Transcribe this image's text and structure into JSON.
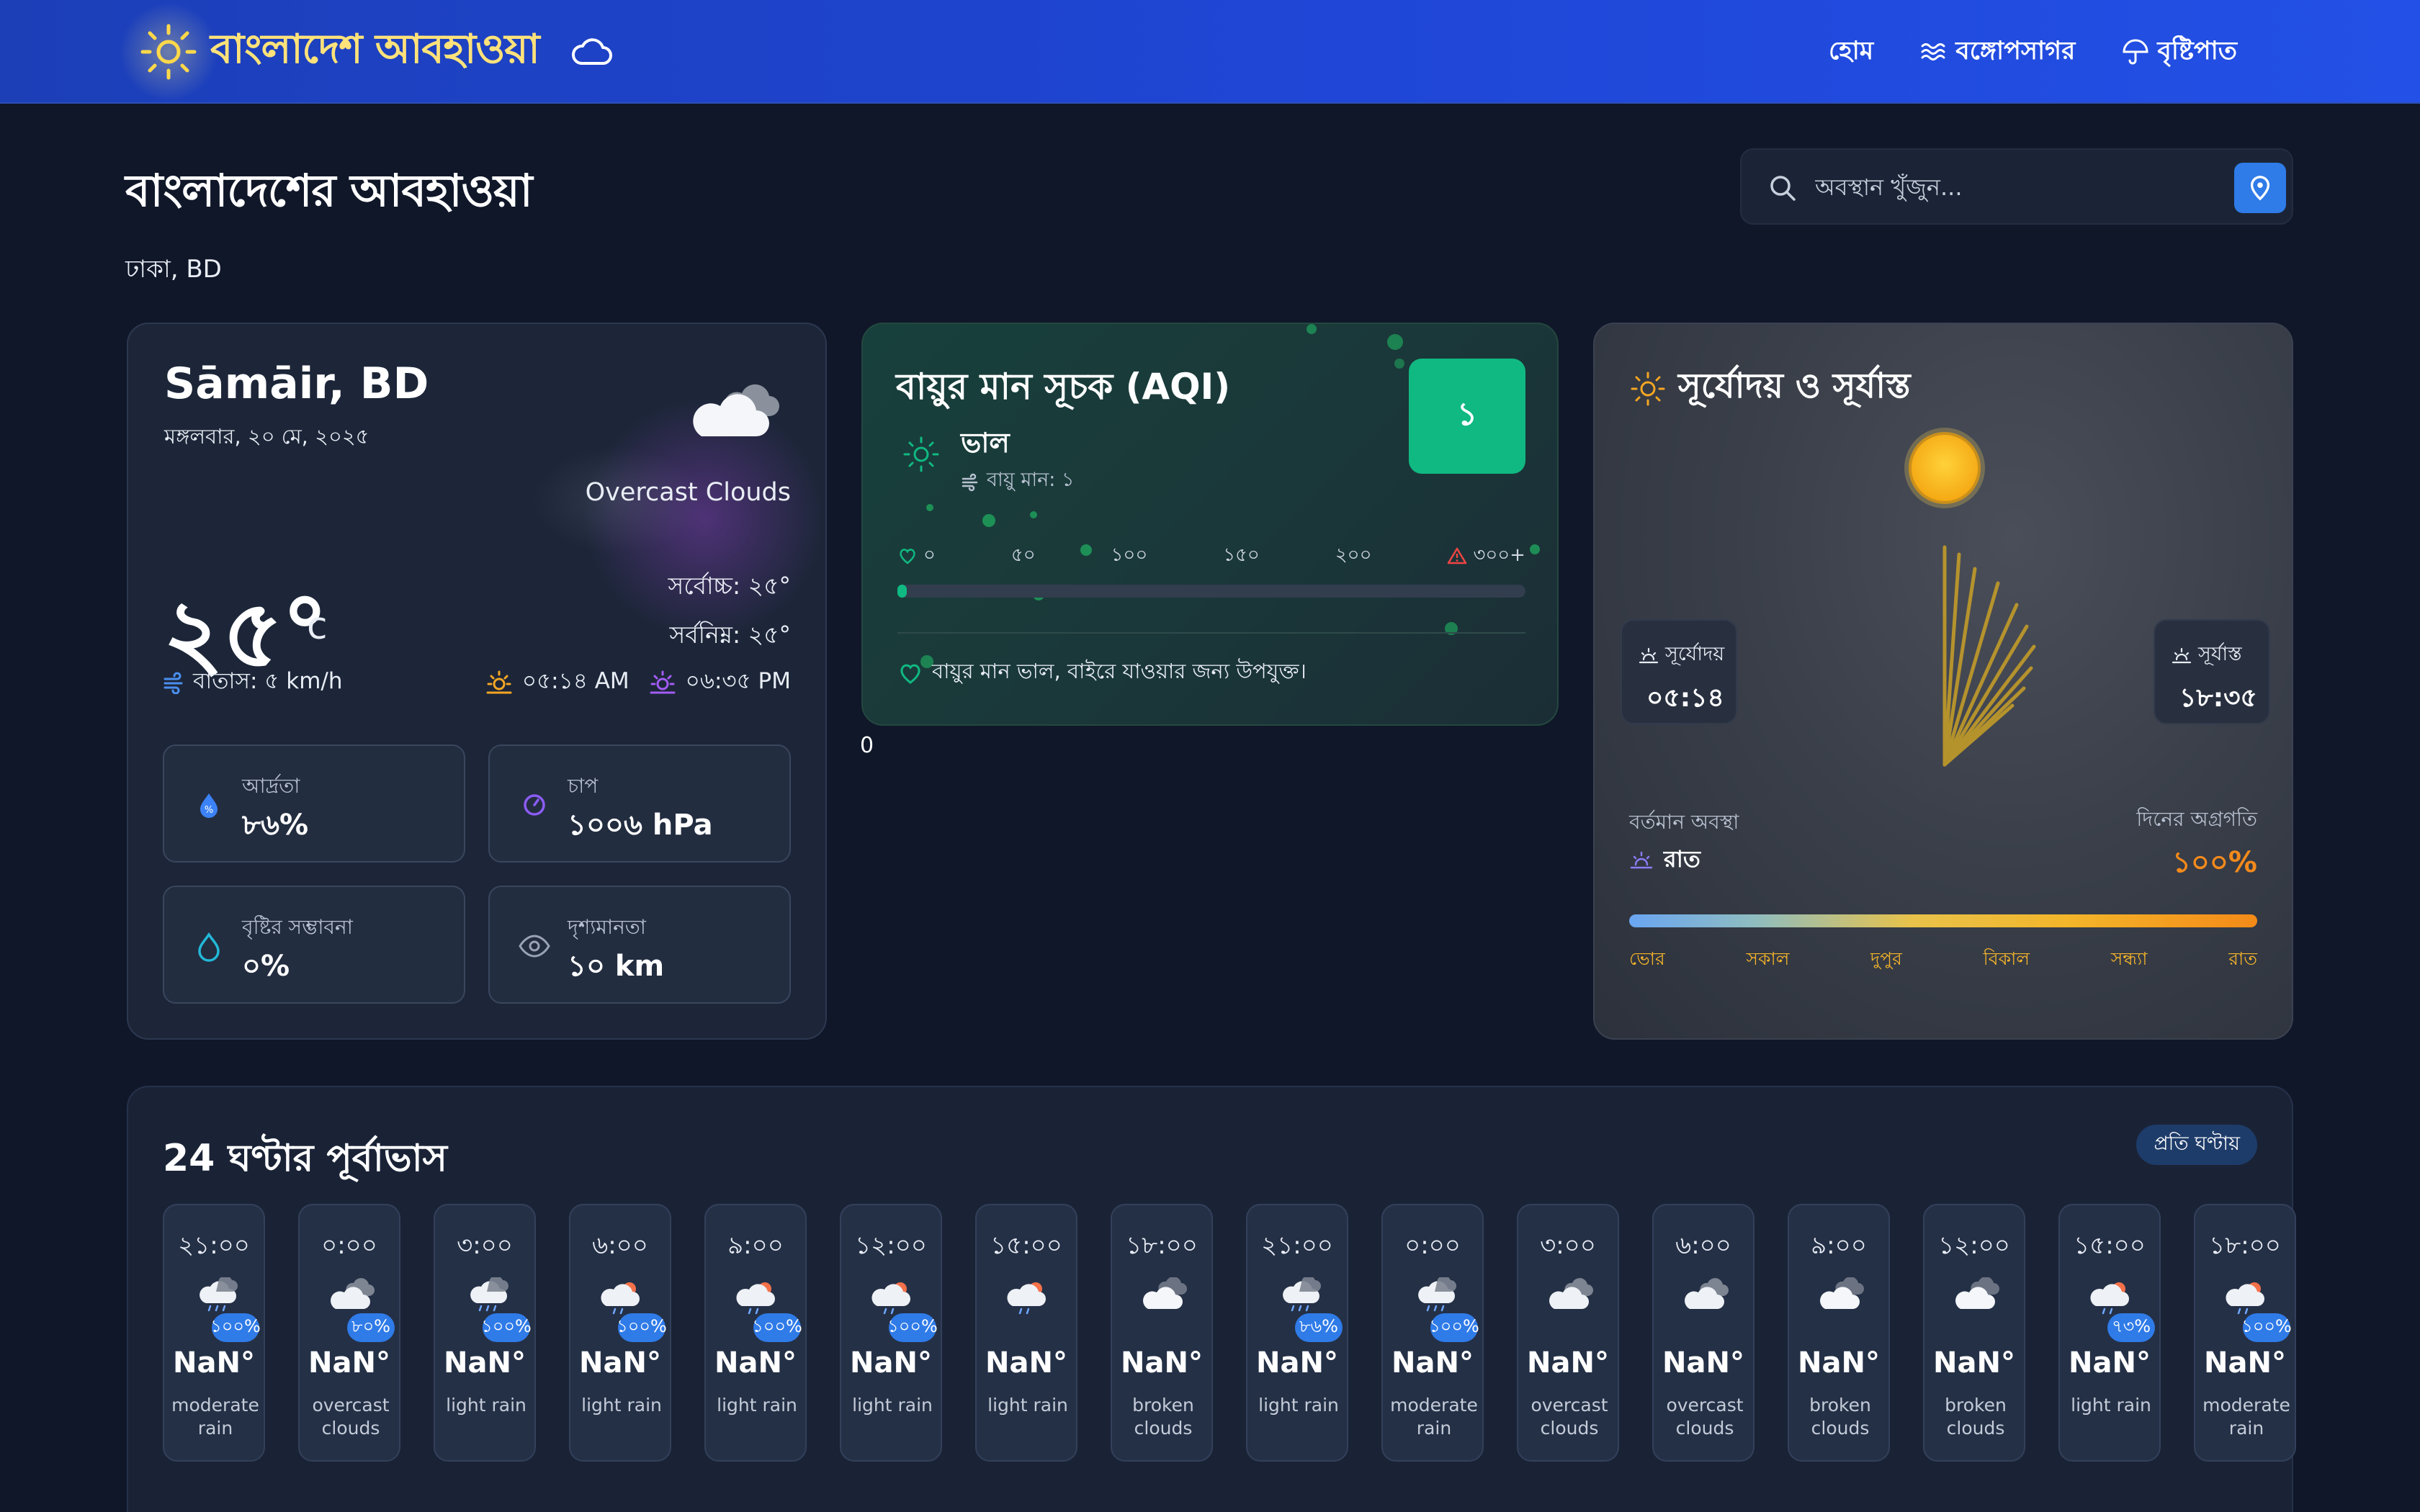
{
  "nav": {
    "brand": "বাংলাদেশ আবহাওয়া",
    "links": [
      "হোম",
      "বঙ্গোপসাগর",
      "বৃষ্টিপাত"
    ]
  },
  "header": {
    "title": "বাংলাদেশের আবহাওয়া",
    "location": "ঢাকা, BD",
    "search_placeholder": "অবস্থান খুঁজুন..."
  },
  "current": {
    "city": "Sāmāir, BD",
    "date": "মঙ্গলবার, ২০ মে, ২০২৫",
    "condition": "Overcast Clouds",
    "temp": "২৫°",
    "unit": "c",
    "max": "সর্বোচ্চ: ২৫°",
    "min": "সর্বনিম্ন: ২৫°",
    "wind": "বাতাস: ৫ km/h",
    "sunrise": "০৫:১৪ AM",
    "sunset": "০৬:৩৫ PM",
    "stats": [
      {
        "label": "আর্দ্রতা",
        "value": "৮৬%",
        "icon": "humidity-icon"
      },
      {
        "label": "চাপ",
        "value": "১০০৬ hPa",
        "icon": "pressure-gauge-icon"
      },
      {
        "label": "বৃষ্টির সম্ভাবনা",
        "value": "০%",
        "icon": "raindrop-icon"
      },
      {
        "label": "দৃশ্যমানতা",
        "value": "১০ km",
        "icon": "eye-icon"
      }
    ]
  },
  "aqi": {
    "title": "বায়ুর মান সূচক (AQI)",
    "value": "১",
    "status": "ভাল",
    "subtitle": "বায়ু মান: ১",
    "scale": [
      "০",
      "৫০",
      "১০০",
      "১৫০",
      "২০০",
      "৩০০+"
    ],
    "level_fraction": 0.003,
    "message": "বায়ুর মান ভাল, বাইরে যাওয়ার জন্য উপযুক্ত।",
    "stray_text": "0",
    "accent": "#10b981"
  },
  "sun": {
    "title": "সূর্যোদয় ও সূর্যাস্ত",
    "sunrise_label": "সূর্যোদয়",
    "sunrise_time": "০৫:১৪",
    "sunset_label": "সূর্যাস্ত",
    "sunset_time": "১৮:৩৫",
    "state_label": "বর্তমান অবস্থা",
    "state_value": "রাত",
    "progress_label": "দিনের অগ্রগতি",
    "progress_value": "১০০%",
    "progress_fraction": 1.0,
    "phases": [
      "ভোর",
      "সকাল",
      "দুপুর",
      "বিকাল",
      "সন্ধ্যা",
      "রাত"
    ]
  },
  "forecast": {
    "title": "24 ঘণ্টার পূর্বাভাস",
    "badge": "প্রতি ঘণ্টায়",
    "hours": [
      {
        "time": "২১:০০",
        "temp": "NaN°",
        "desc": "moderate rain",
        "pop": "১০০%",
        "icon": "rain-cloud-icon"
      },
      {
        "time": "০:০০",
        "temp": "NaN°",
        "desc": "overcast clouds",
        "pop": "৮০%",
        "icon": "overcast-cloud-icon"
      },
      {
        "time": "৩:০০",
        "temp": "NaN°",
        "desc": "light rain",
        "pop": "১০০%",
        "icon": "rain-cloud-icon"
      },
      {
        "time": "৬:০০",
        "temp": "NaN°",
        "desc": "light rain",
        "pop": "১০০%",
        "icon": "sun-rain-icon"
      },
      {
        "time": "৯:০০",
        "temp": "NaN°",
        "desc": "light rain",
        "pop": "১০০%",
        "icon": "sun-rain-icon"
      },
      {
        "time": "১২:০০",
        "temp": "NaN°",
        "desc": "light rain",
        "pop": "১০০%",
        "icon": "sun-rain-icon"
      },
      {
        "time": "১৫:০০",
        "temp": "NaN°",
        "desc": "light rain",
        "pop": "",
        "icon": "sun-rain-icon"
      },
      {
        "time": "১৮:০০",
        "temp": "NaN°",
        "desc": "broken clouds",
        "pop": "",
        "icon": "cloud-icon"
      },
      {
        "time": "২১:০০",
        "temp": "NaN°",
        "desc": "light rain",
        "pop": "৮৬%",
        "icon": "rain-cloud-icon"
      },
      {
        "time": "০:০০",
        "temp": "NaN°",
        "desc": "moderate rain",
        "pop": "১০০%",
        "icon": "rain-cloud-icon"
      },
      {
        "time": "৩:০০",
        "temp": "NaN°",
        "desc": "overcast clouds",
        "pop": "",
        "icon": "overcast-cloud-icon"
      },
      {
        "time": "৬:০০",
        "temp": "NaN°",
        "desc": "overcast clouds",
        "pop": "",
        "icon": "overcast-cloud-icon"
      },
      {
        "time": "৯:০০",
        "temp": "NaN°",
        "desc": "broken clouds",
        "pop": "",
        "icon": "cloud-icon"
      },
      {
        "time": "১২:০০",
        "temp": "NaN°",
        "desc": "broken clouds",
        "pop": "",
        "icon": "cloud-icon"
      },
      {
        "time": "১৫:০০",
        "temp": "NaN°",
        "desc": "light rain",
        "pop": "৭৩%",
        "icon": "sun-rain-icon"
      },
      {
        "time": "১৮:০০",
        "temp": "NaN°",
        "desc": "moderate rain",
        "pop": "১০০%",
        "icon": "sun-rain-icon"
      }
    ]
  }
}
